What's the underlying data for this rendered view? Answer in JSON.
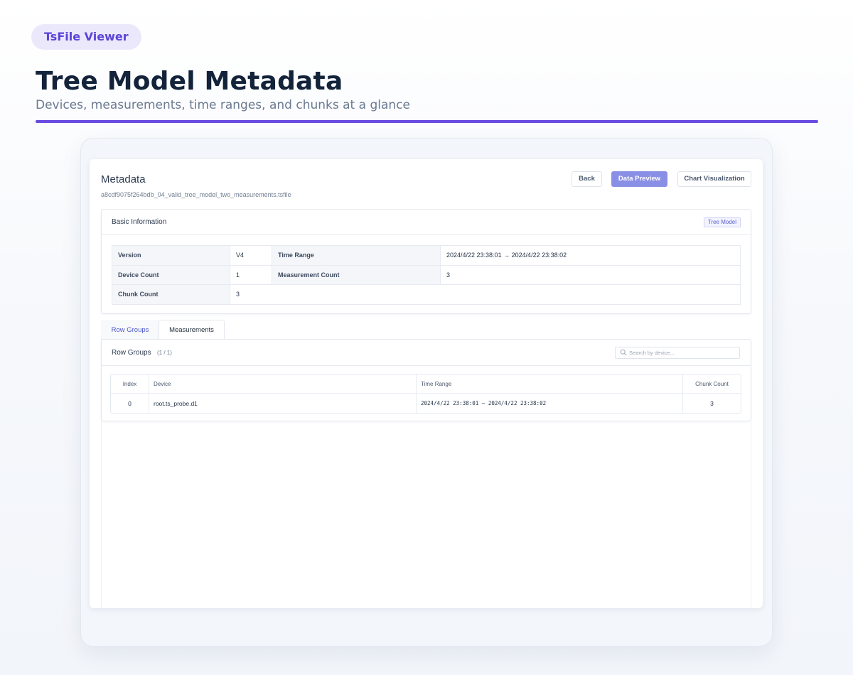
{
  "header": {
    "app_badge": "TsFile Viewer",
    "title": "Tree Model Metadata",
    "subtitle": "Devices, measurements, time ranges, and chunks at a glance"
  },
  "window": {
    "title": "Metadata",
    "filename": "a8cdf9075f264bdb_04_valid_tree_model_two_measurements.tsfile",
    "buttons": {
      "back": "Back",
      "data_preview": "Data Preview",
      "chart_visualization": "Chart Visualization"
    }
  },
  "basic_info": {
    "title": "Basic Information",
    "model_badge": "Tree Model",
    "rows": [
      {
        "l1": "Version",
        "v1": "V4",
        "l2": "Time Range",
        "v2": "2024/4/22 23:38:01 → 2024/4/22 23:38:02"
      },
      {
        "l1": "Device Count",
        "v1": "1",
        "l2": "Measurement Count",
        "v2": "3"
      },
      {
        "l1": "Chunk Count",
        "v1": "3"
      }
    ]
  },
  "tabs": {
    "row_groups": "Row Groups",
    "measurements": "Measurements"
  },
  "row_groups": {
    "title": "Row Groups",
    "count": "(1 / 1)",
    "search_placeholder": "Search by device...",
    "columns": {
      "index": "Index",
      "device": "Device",
      "time_range": "Time Range",
      "chunk_count": "Chunk Count"
    },
    "rows": [
      {
        "index": "0",
        "device": "root.ts_probe.d1",
        "time_range": "2024/4/22 23:38:01 ~ 2024/4/22 23:38:02",
        "chunk_count": "3"
      }
    ]
  },
  "colors": {
    "accent": "#6a4ce0",
    "primary_button": "#8a8fe6",
    "tab_active_text": "#4a57c9"
  }
}
